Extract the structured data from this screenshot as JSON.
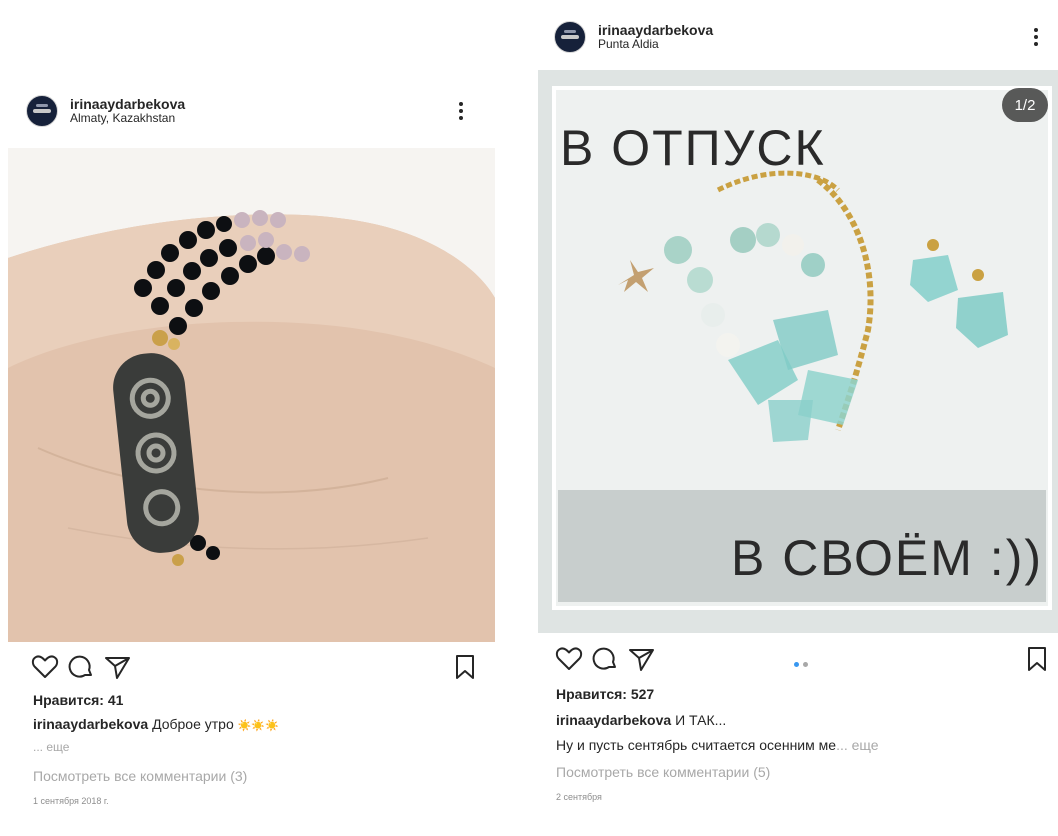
{
  "posts": [
    {
      "username": "irinaaydarbekova",
      "location": "Almaty, Kazakhstan",
      "likes": "Нравится: 41",
      "caption_text": "Доброе утро",
      "caption_emoji": "☀️☀️☀️",
      "caption_more": "... еще",
      "view_comments": "Посмотреть все комментарии (3)",
      "date": "1 сентября 2018 г."
    },
    {
      "username": "irinaaydarbekova",
      "location": "Punta Aldia",
      "counter": "1/2",
      "image_title_top": "В ОТПУСК",
      "image_title_bottom": "В СВОЁМ :))",
      "likes": "Нравится: 527",
      "caption_text": "И ТАК...",
      "caption_line2": "Ну и пусть сентябрь считается осенним ме",
      "caption_more": "... еще",
      "view_comments": "Посмотреть все комментарии (5)",
      "date": "2 сентября"
    }
  ],
  "colors": {
    "text": "#262626",
    "muted": "#a8a8a8",
    "carousel_dot_active": "#3897f0",
    "carousel_dot_inactive": "#a8a8a8"
  },
  "icons": [
    "heart-icon",
    "comment-icon",
    "share-icon",
    "bookmark-icon",
    "more-icon"
  ]
}
